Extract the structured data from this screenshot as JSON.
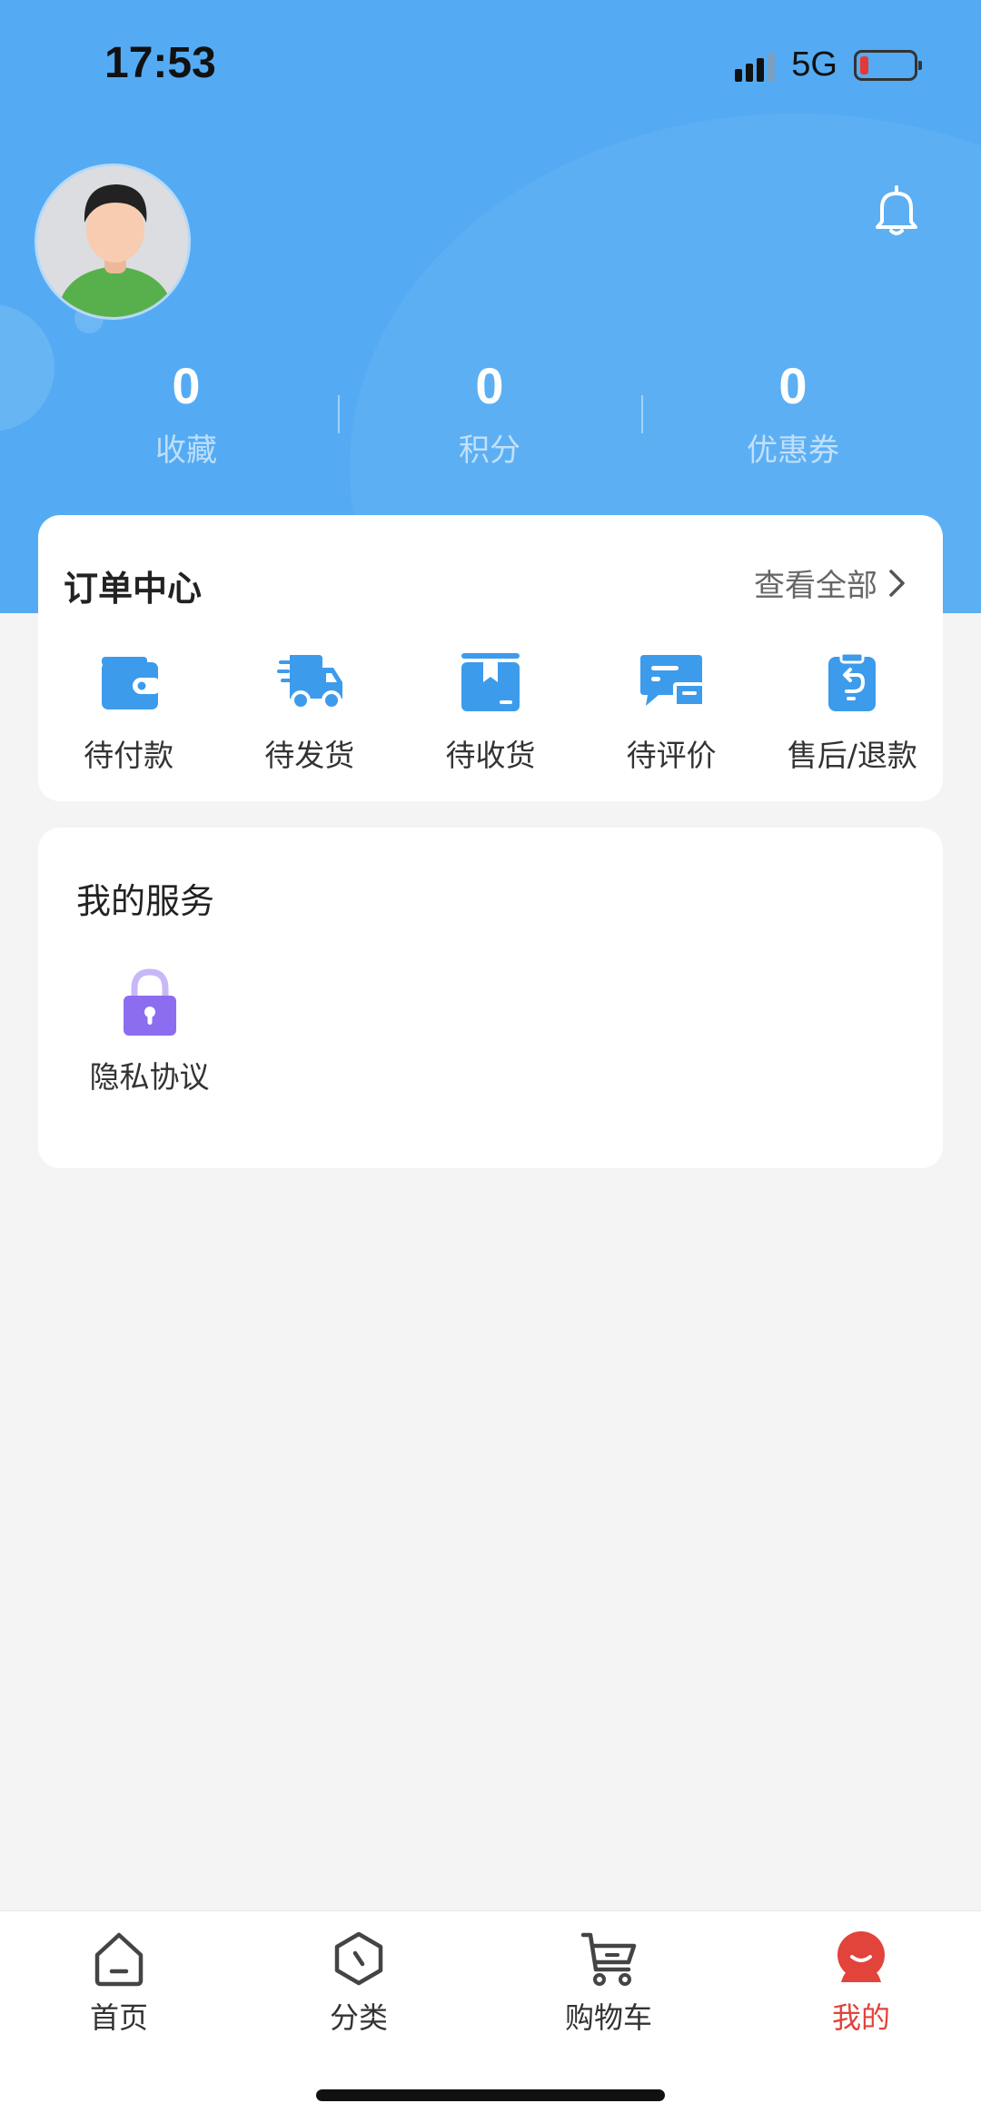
{
  "status_bar": {
    "time": "17:53",
    "network": "5G",
    "battery_level": 0.1
  },
  "header": {
    "stats": [
      {
        "value": "0",
        "label": "收藏"
      },
      {
        "value": "0",
        "label": "积分"
      },
      {
        "value": "0",
        "label": "优惠券"
      }
    ]
  },
  "orders": {
    "title": "订单中心",
    "view_all": "查看全部",
    "items": [
      {
        "label": "待付款",
        "icon": "wallet-icon"
      },
      {
        "label": "待发货",
        "icon": "delivery-truck-icon"
      },
      {
        "label": "待收货",
        "icon": "package-box-icon"
      },
      {
        "label": "待评价",
        "icon": "review-chat-icon"
      },
      {
        "label": "售后/退款",
        "icon": "refund-icon"
      }
    ]
  },
  "services": {
    "title": "我的服务",
    "items": [
      {
        "label": "隐私协议",
        "icon": "lock-icon"
      }
    ]
  },
  "tabbar": {
    "active": "我的",
    "tabs": [
      {
        "label": "首页",
        "icon": "home-icon"
      },
      {
        "label": "分类",
        "icon": "category-icon"
      },
      {
        "label": "购物车",
        "icon": "cart-icon"
      },
      {
        "label": "我的",
        "icon": "profile-icon"
      }
    ]
  },
  "colors": {
    "primary": "#54abf3",
    "icon_blue": "#3d9bec",
    "accent_red": "#e2433b",
    "lock_purple": "#8c6df0"
  }
}
